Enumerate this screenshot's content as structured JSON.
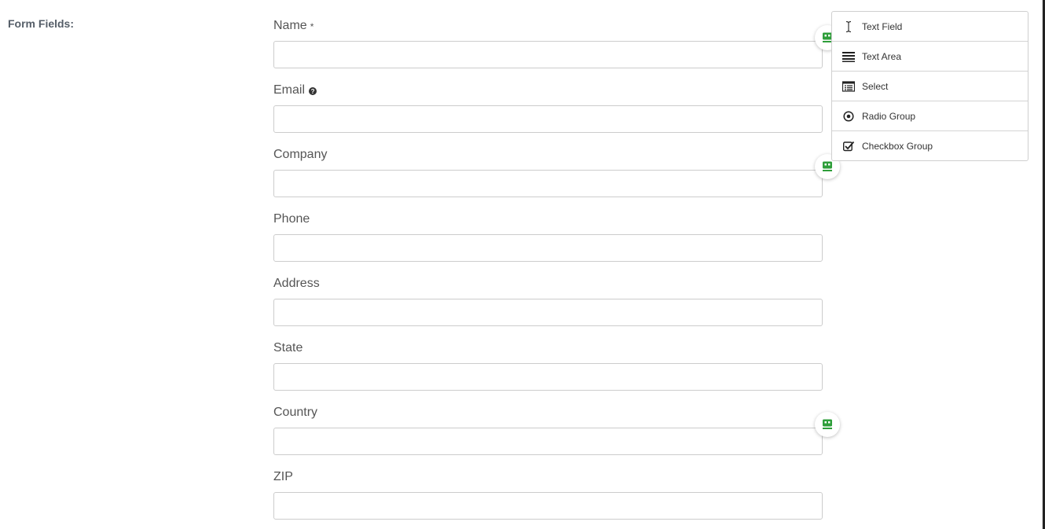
{
  "section": {
    "label": "Form Fields:"
  },
  "fields": [
    {
      "label": "Name",
      "required_mark": "*",
      "value": ""
    },
    {
      "label": "Email",
      "help_icon": "question-circle-icon",
      "value": ""
    },
    {
      "label": "Company",
      "value": ""
    },
    {
      "label": "Phone",
      "value": ""
    },
    {
      "label": "Address",
      "value": ""
    },
    {
      "label": "State",
      "value": ""
    },
    {
      "label": "Country",
      "value": ""
    },
    {
      "label": "ZIP",
      "value": ""
    }
  ],
  "autofill_badge": {
    "icon": "contact-card-icon",
    "color": "#2e9e3a"
  },
  "palette": {
    "items": [
      {
        "label": "Text Field",
        "icon": "text-cursor-icon"
      },
      {
        "label": "Text Area",
        "icon": "text-lines-icon"
      },
      {
        "label": "Select",
        "icon": "select-list-icon"
      },
      {
        "label": "Radio Group",
        "icon": "radio-icon"
      },
      {
        "label": "Checkbox Group",
        "icon": "checkbox-icon"
      }
    ]
  }
}
